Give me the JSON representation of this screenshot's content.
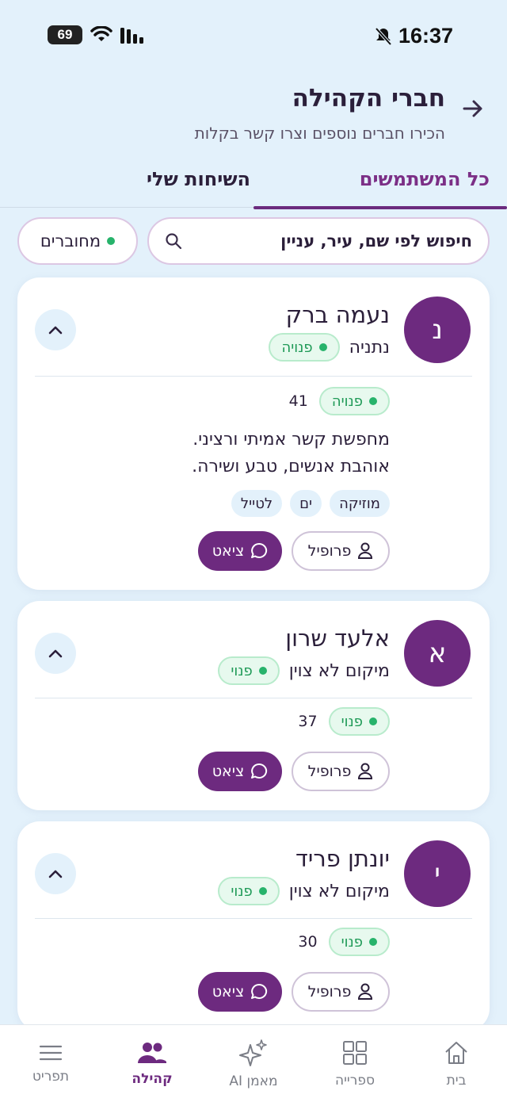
{
  "status_bar": {
    "time": "16:37",
    "battery": "69"
  },
  "header": {
    "title": "חברי הקהילה",
    "subtitle": "הכירו חברים נוספים וצרו קשר בקלות"
  },
  "tabs": [
    {
      "label": "כל המשתמשים",
      "active": true
    },
    {
      "label": "השיחות שלי",
      "active": false
    }
  ],
  "search": {
    "placeholder": "חיפוש לפי שם, עיר, עניין"
  },
  "filter": {
    "label": "מחוברים"
  },
  "members": [
    {
      "initial": "נ",
      "name": "נעמה ברק",
      "location": "נתניה",
      "status": "פנויה",
      "age": "41",
      "bio_line1": "מחפשת קשר אמיתי ורציני.",
      "bio_line2": "אוהבת אנשים, טבע ושירה.",
      "interests": [
        "מוזיקה",
        "ים",
        "לטייל"
      ],
      "profile_label": "פרופיל",
      "chat_label": "ציאט"
    },
    {
      "initial": "א",
      "name": "אלעד שרון",
      "location": "מיקום לא צוין",
      "status": "פנוי",
      "age": "37",
      "profile_label": "פרופיל",
      "chat_label": "ציאט"
    },
    {
      "initial": "י",
      "name": "יונתן פריד",
      "location": "מיקום לא צוין",
      "status": "פנוי",
      "age": "30",
      "profile_label": "פרופיל",
      "chat_label": "ציאט"
    }
  ],
  "nav": [
    {
      "label": "בית",
      "icon": "home-icon"
    },
    {
      "label": "ספרייה",
      "icon": "grid-icon"
    },
    {
      "label": "מאמן AI",
      "icon": "sparkle-icon"
    },
    {
      "label": "קהילה",
      "icon": "people-icon",
      "active": true
    },
    {
      "label": "תפריט",
      "icon": "menu-icon"
    }
  ],
  "colors": {
    "accent": "#6d2a7f",
    "available": "#27b36b",
    "background": "#e3f1fb"
  }
}
